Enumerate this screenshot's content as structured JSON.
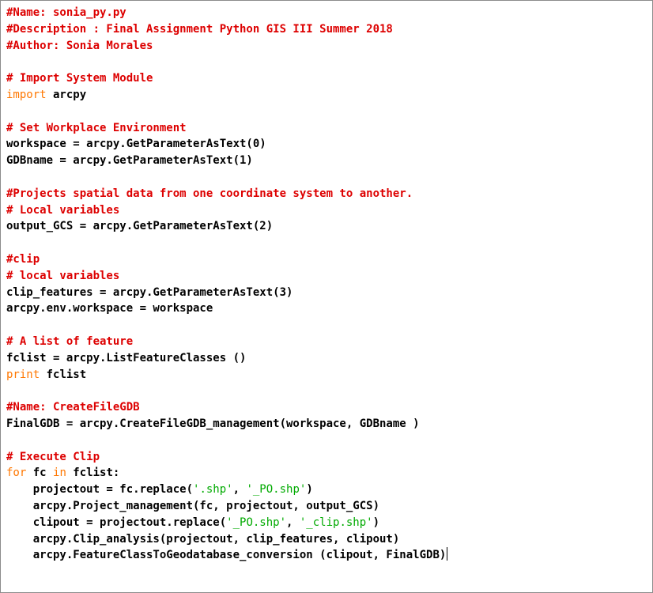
{
  "editor": {
    "lines": [
      [
        {
          "t": "#Name: sonia_py.py",
          "k": "comment"
        }
      ],
      [
        {
          "t": "#Description : Final Assignment Python GIS III Summer 2018",
          "k": "comment"
        }
      ],
      [
        {
          "t": "#Author: Sonia Morales",
          "k": "comment"
        }
      ],
      [],
      [
        {
          "t": "# Import System Module",
          "k": "comment"
        }
      ],
      [
        {
          "t": "import",
          "k": "keyword"
        },
        {
          "t": " arcpy",
          "k": "plain"
        }
      ],
      [],
      [
        {
          "t": "# Set Workplace Environment",
          "k": "comment"
        }
      ],
      [
        {
          "t": "workspace = arcpy.GetParameterAsText(0)",
          "k": "plain"
        }
      ],
      [
        {
          "t": "GDBname = arcpy.GetParameterAsText(1)",
          "k": "plain"
        }
      ],
      [],
      [
        {
          "t": "#Projects spatial data from one coordinate system to another.",
          "k": "comment"
        }
      ],
      [
        {
          "t": "# Local variables",
          "k": "comment"
        }
      ],
      [
        {
          "t": "output_GCS = arcpy.GetParameterAsText(2)",
          "k": "plain"
        }
      ],
      [],
      [
        {
          "t": "#clip",
          "k": "comment"
        }
      ],
      [
        {
          "t": "# local variables",
          "k": "comment"
        }
      ],
      [
        {
          "t": "clip_features = arcpy.GetParameterAsText(3)",
          "k": "plain"
        }
      ],
      [
        {
          "t": "arcpy.env.workspace = workspace",
          "k": "plain"
        }
      ],
      [],
      [
        {
          "t": "# A list of feature",
          "k": "comment"
        }
      ],
      [
        {
          "t": "fclist = arcpy.ListFeatureClasses ()",
          "k": "plain"
        }
      ],
      [
        {
          "t": "print",
          "k": "keyword"
        },
        {
          "t": " fclist",
          "k": "plain"
        }
      ],
      [],
      [
        {
          "t": "#Name: CreateFileGDB",
          "k": "comment"
        }
      ],
      [
        {
          "t": "FinalGDB = arcpy.CreateFileGDB_management(workspace, GDBname )",
          "k": "plain"
        }
      ],
      [],
      [
        {
          "t": "# Execute Clip",
          "k": "comment"
        }
      ],
      [
        {
          "t": "for",
          "k": "keyword"
        },
        {
          "t": " fc ",
          "k": "plain"
        },
        {
          "t": "in",
          "k": "keyword"
        },
        {
          "t": " fclist:",
          "k": "plain"
        }
      ],
      [
        {
          "t": "    projectout = fc.replace(",
          "k": "plain"
        },
        {
          "t": "'.shp'",
          "k": "string"
        },
        {
          "t": ", ",
          "k": "plain"
        },
        {
          "t": "'_PO.shp'",
          "k": "string"
        },
        {
          "t": ")",
          "k": "plain"
        }
      ],
      [
        {
          "t": "    arcpy.Project_management(fc, projectout, output_GCS)",
          "k": "plain"
        }
      ],
      [
        {
          "t": "    clipout = projectout.replace(",
          "k": "plain"
        },
        {
          "t": "'_PO.shp'",
          "k": "string"
        },
        {
          "t": ", ",
          "k": "plain"
        },
        {
          "t": "'_clip.shp'",
          "k": "string"
        },
        {
          "t": ")",
          "k": "plain"
        }
      ],
      [
        {
          "t": "    arcpy.Clip_analysis(projectout, clip_features, clipout)",
          "k": "plain"
        }
      ],
      [
        {
          "t": "    arcpy.FeatureClassToGeodatabase_conversion (clipout, FinalGDB)",
          "k": "plain"
        }
      ]
    ],
    "caret_line": 34,
    "colors": {
      "comment": "#dd0000",
      "keyword": "#ff7700",
      "string": "#00aa00",
      "plain": "#000000"
    }
  }
}
